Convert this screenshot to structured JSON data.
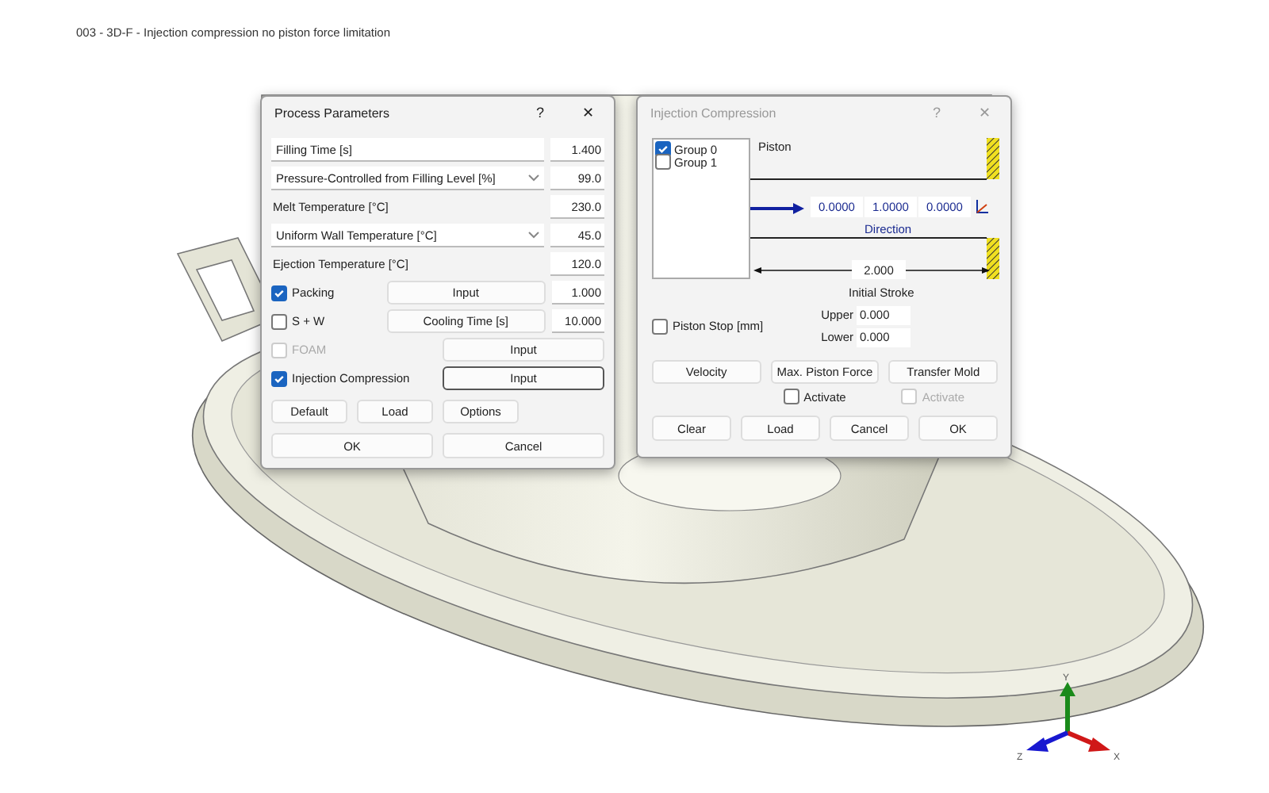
{
  "caption": "003 - 3D-F - Injection compression no piston force limitation",
  "process_dialog": {
    "title": "Process Parameters",
    "active": true,
    "help": "?",
    "close": "✕",
    "rows": [
      {
        "kind": "field",
        "label": "Filling Time [s]",
        "value": "1.400"
      },
      {
        "kind": "dropdown",
        "label": "Pressure-Controlled from Filling Level [%]",
        "value": "99.0"
      },
      {
        "kind": "label",
        "label": "Melt Temperature [°C]",
        "value": "230.0"
      },
      {
        "kind": "dropdown",
        "label": "Uniform Wall Temperature [°C]",
        "value": "45.0"
      },
      {
        "kind": "label",
        "label": "Ejection Temperature [°C]",
        "value": "120.0"
      },
      {
        "kind": "check",
        "label": "Packing",
        "checked": true,
        "disabled": false,
        "button": "Input",
        "value": "1.000"
      },
      {
        "kind": "check",
        "label": "S + W",
        "checked": false,
        "disabled": false,
        "button": "Cooling Time [s]",
        "value": "10.000"
      },
      {
        "kind": "check_wide",
        "label": "FOAM",
        "checked": false,
        "disabled": true,
        "button": "Input",
        "focused": false
      },
      {
        "kind": "check_wide",
        "label": "Injection Compression",
        "checked": true,
        "disabled": false,
        "button": "Input",
        "focused": true
      }
    ],
    "tools": [
      "Default",
      "Load",
      "Options"
    ],
    "ok": "OK",
    "cancel": "Cancel"
  },
  "compression_dialog": {
    "title": "Injection Compression",
    "active": false,
    "help": "?",
    "close": "✕",
    "groups": [
      {
        "label": "Group 0",
        "checked": true
      },
      {
        "label": "Group 1",
        "checked": false
      }
    ],
    "piston": "Piston",
    "direction": [
      "0.0000",
      "1.0000",
      "0.0000"
    ],
    "direction_label": "Direction",
    "stroke": "2.000",
    "stroke_label": "Initial Stroke",
    "piston_stop": {
      "label": "Piston Stop [mm]",
      "checked": false
    },
    "limits": [
      {
        "label": "Upper",
        "value": "0.000"
      },
      {
        "label": "Lower",
        "value": "0.000"
      }
    ],
    "actions": [
      {
        "label": "Velocity"
      },
      {
        "label": "Max. Piston Force",
        "activate": {
          "label": "Activate",
          "checked": false,
          "disabled": false
        }
      },
      {
        "label": "Transfer Mold",
        "activate": {
          "label": "Activate",
          "checked": false,
          "disabled": true
        }
      }
    ],
    "buttons": [
      "Clear",
      "Load",
      "Cancel",
      "OK"
    ]
  },
  "axes": {
    "y": "Y",
    "z": "Z",
    "x": "X"
  }
}
